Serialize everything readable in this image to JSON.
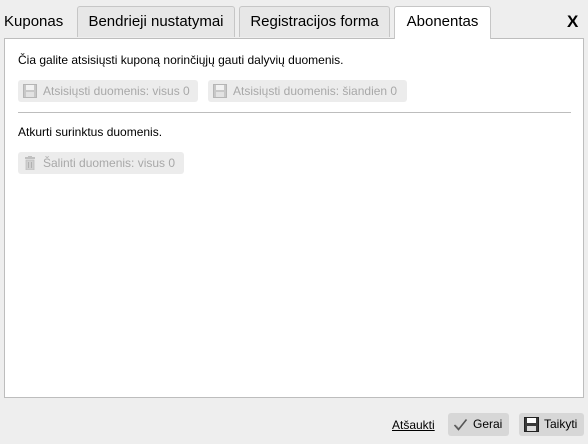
{
  "dialog": {
    "title": "Kuponas",
    "close_label": "X"
  },
  "tabs": [
    {
      "label": "Bendrieji nustatymai",
      "active": false
    },
    {
      "label": "Registracijos forma",
      "active": false
    },
    {
      "label": "Abonentas",
      "active": true
    }
  ],
  "panel": {
    "download_text": "Čia galite atsisiųsti kuponą norinčiųjų gauti dalyvių duomenis.",
    "download_all_label": "Atsisiųsti duomenis: visus 0",
    "download_today_label": "Atsisiųsti duomenis: šiandien 0",
    "reset_text": "Atkurti surinktus duomenis.",
    "delete_all_label": "Šalinti duomenis: visus 0"
  },
  "footer": {
    "cancel_label": "Atšaukti",
    "ok_label": "Gerai",
    "apply_label": "Taikyti"
  },
  "icons": {
    "download": "floppy-disk-icon",
    "delete": "trash-icon",
    "ok": "checkmark-icon",
    "apply": "floppy-disk-icon"
  }
}
